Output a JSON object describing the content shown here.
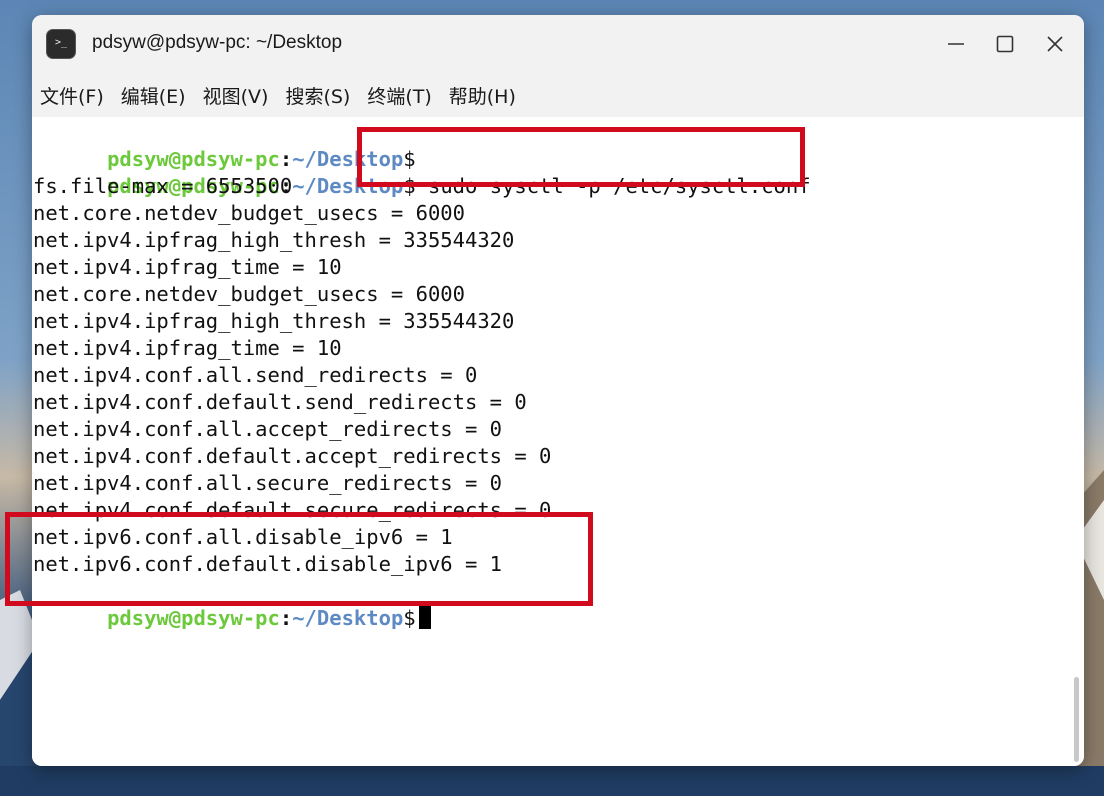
{
  "window": {
    "title": "pdsyw@pdsyw-pc: ~/Desktop",
    "app_icon_glyph": ">_"
  },
  "menu": {
    "items": [
      "文件(F)",
      "编辑(E)",
      "视图(V)",
      "搜索(S)",
      "终端(T)",
      "帮助(H)"
    ]
  },
  "prompt": {
    "user": "pdsyw@pdsyw-pc",
    "colon": ":",
    "path": "~/Desktop",
    "dollar": "$"
  },
  "terminal": {
    "command": " sudo sysctl -p /etc/sysctl.conf",
    "output": [
      "fs.file-max = 6553500",
      "net.core.netdev_budget_usecs = 6000",
      "net.ipv4.ipfrag_high_thresh = 335544320",
      "net.ipv4.ipfrag_time = 10",
      "net.core.netdev_budget_usecs = 6000",
      "net.ipv4.ipfrag_high_thresh = 335544320",
      "net.ipv4.ipfrag_time = 10",
      "net.ipv4.conf.all.send_redirects = 0",
      "net.ipv4.conf.default.send_redirects = 0",
      "net.ipv4.conf.all.accept_redirects = 0",
      "net.ipv4.conf.default.accept_redirects = 0",
      "net.ipv4.conf.all.secure_redirects = 0",
      "net.ipv4.conf.default.secure_redirects = 0",
      "net.ipv6.conf.all.disable_ipv6 = 1",
      "net.ipv6.conf.default.disable_ipv6 = 1"
    ]
  },
  "colors": {
    "prompt_user": "#6cc93c",
    "prompt_path": "#5e8ac4",
    "highlight_box": "#d20a1e"
  },
  "icons": [
    "terminal-app-icon",
    "minimize-icon",
    "maximize-icon",
    "close-icon"
  ]
}
